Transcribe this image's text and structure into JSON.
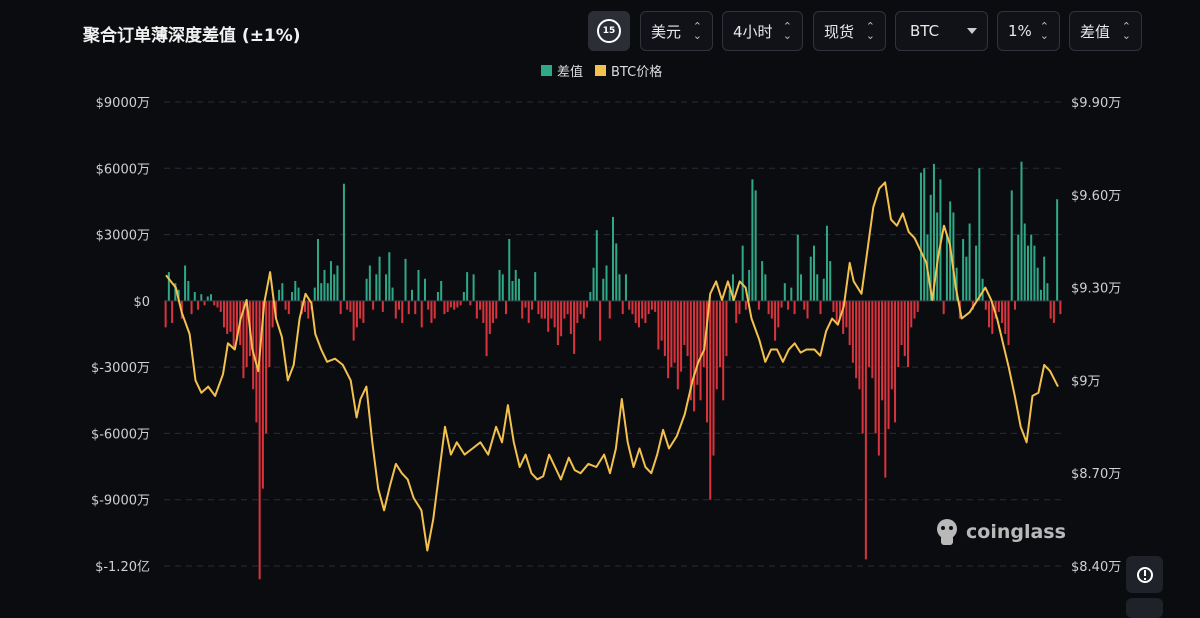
{
  "title": "聚合订单薄深度差值 (±1%)",
  "toolbar": {
    "interval_badge": "15",
    "currency": "美元",
    "timeframe": "4小时",
    "market": "现货",
    "coin": "BTC",
    "range": "1%",
    "metric": "差值"
  },
  "watermark": "coinglass",
  "chart_data": {
    "type": "bar",
    "left_axis_ticks": [
      "$9000万",
      "$6000万",
      "$3000万",
      "$0",
      "$-3000万",
      "$-6000万",
      "$-9000万",
      "$-1.20亿"
    ],
    "right_axis_ticks": [
      "$9.90万",
      "$9.60万",
      "$9.30万",
      "$9万",
      "$8.70万",
      "$8.40万"
    ],
    "left_ylim": [
      -120000000,
      90000000
    ],
    "right_ylim": [
      84000,
      99000
    ],
    "grid": true,
    "legend_position": "top-center",
    "colors": {
      "positive": "#2ea886",
      "negative": "#d9343d",
      "price": "#f2c14e"
    },
    "series": [
      {
        "name": "差值",
        "axis": "left",
        "values_million": [
          -12,
          13,
          -10,
          8,
          5,
          -8,
          16,
          9,
          -6,
          4,
          -4,
          3,
          -2,
          2,
          3,
          -2,
          -3,
          -5,
          -12,
          -15,
          -14,
          -22,
          -18,
          -20,
          -35,
          -30,
          -25,
          -40,
          -55,
          -126,
          -85,
          -60,
          -30,
          -12,
          -8,
          5,
          8,
          -4,
          -6,
          4,
          9,
          6,
          -6,
          -5,
          -8,
          -4,
          6,
          28,
          8,
          14,
          8,
          18,
          12,
          16,
          -6,
          53,
          -4,
          -5,
          -18,
          -12,
          -8,
          -10,
          10,
          16,
          -4,
          12,
          20,
          -5,
          12,
          22,
          6,
          -8,
          -4,
          -10,
          19,
          -6,
          5,
          -6,
          14,
          -12,
          10,
          -4,
          -10,
          -8,
          4,
          9,
          -6,
          -5,
          -3,
          -4,
          -3,
          -2,
          4,
          13,
          -2,
          12,
          -8,
          -4,
          -10,
          -25,
          -15,
          -10,
          -8,
          14,
          12,
          -6,
          28,
          9,
          14,
          10,
          -8,
          -3,
          -10,
          -4,
          13,
          -6,
          -8,
          -8,
          -14,
          -8,
          -12,
          -20,
          -16,
          -8,
          -6,
          -15,
          -24,
          -10,
          -6,
          -8,
          -3,
          4,
          15,
          32,
          -18,
          10,
          16,
          -8,
          38,
          26,
          12,
          -6,
          12,
          -4,
          -6,
          -10,
          -12,
          -8,
          -10,
          -6,
          -4,
          -5,
          -22,
          -18,
          -25,
          -35,
          -30,
          -28,
          -40,
          -32,
          -20,
          -25,
          -45,
          -50,
          -38,
          -45,
          -30,
          -55,
          -90,
          -70,
          -40,
          -30,
          -45,
          -25,
          5,
          12,
          -10,
          -6,
          25,
          -4,
          14,
          55,
          50,
          -4,
          18,
          12,
          -6,
          -8,
          -18,
          -12,
          -3,
          8,
          -4,
          6,
          -6,
          30,
          12,
          -4,
          -8,
          20,
          25,
          12,
          -6,
          10,
          34,
          18,
          -5,
          -10,
          -8,
          -15,
          -12,
          -20,
          -28,
          -35,
          -40,
          -60,
          -117,
          -30,
          -35,
          -60,
          -70,
          -45,
          -80,
          -58,
          -40,
          -55,
          -30,
          -20,
          -25,
          -30,
          -12,
          -8,
          -5,
          58,
          60,
          30,
          48,
          62,
          40,
          55,
          -6,
          30,
          45,
          40,
          15,
          -8,
          28,
          20,
          35,
          -4,
          25,
          60,
          10,
          -4,
          -12,
          -15,
          -8,
          -5,
          -10,
          -15,
          -20,
          50,
          -4,
          30,
          63,
          35,
          25,
          30,
          25,
          15,
          5,
          20,
          8,
          -8,
          -10,
          46,
          -6
        ]
      },
      {
        "name": "BTC价格",
        "axis": "right",
        "x_span": [
          0,
          1
        ],
        "values": [
          [
            0.0,
            93.4
          ],
          [
            0.01,
            93.0
          ],
          [
            0.016,
            92.2
          ],
          [
            0.024,
            91.5
          ],
          [
            0.03,
            90.0
          ],
          [
            0.036,
            89.6
          ],
          [
            0.043,
            89.8
          ],
          [
            0.05,
            89.5
          ],
          [
            0.058,
            90.2
          ],
          [
            0.063,
            91.2
          ],
          [
            0.07,
            91.0
          ],
          [
            0.076,
            92.0
          ],
          [
            0.082,
            92.6
          ],
          [
            0.088,
            91.0
          ],
          [
            0.094,
            90.3
          ],
          [
            0.1,
            92.5
          ],
          [
            0.106,
            93.5
          ],
          [
            0.112,
            92.0
          ],
          [
            0.118,
            91.4
          ],
          [
            0.124,
            90.0
          ],
          [
            0.13,
            90.5
          ],
          [
            0.136,
            92.0
          ],
          [
            0.142,
            92.8
          ],
          [
            0.148,
            92.5
          ],
          [
            0.152,
            91.5
          ],
          [
            0.158,
            91.0
          ],
          [
            0.164,
            90.6
          ],
          [
            0.172,
            90.7
          ],
          [
            0.18,
            90.5
          ],
          [
            0.188,
            90.0
          ],
          [
            0.194,
            88.8
          ],
          [
            0.198,
            89.4
          ],
          [
            0.204,
            89.8
          ],
          [
            0.21,
            88.0
          ],
          [
            0.216,
            86.5
          ],
          [
            0.222,
            85.8
          ],
          [
            0.228,
            86.6
          ],
          [
            0.234,
            87.3
          ],
          [
            0.24,
            87.0
          ],
          [
            0.246,
            86.8
          ],
          [
            0.252,
            86.2
          ],
          [
            0.26,
            85.8
          ],
          [
            0.266,
            84.5
          ],
          [
            0.272,
            85.5
          ],
          [
            0.278,
            87.0
          ],
          [
            0.284,
            88.5
          ],
          [
            0.29,
            87.6
          ],
          [
            0.296,
            88.0
          ],
          [
            0.304,
            87.6
          ],
          [
            0.312,
            87.8
          ],
          [
            0.32,
            88.0
          ],
          [
            0.328,
            87.6
          ],
          [
            0.336,
            88.5
          ],
          [
            0.342,
            88.0
          ],
          [
            0.348,
            89.2
          ],
          [
            0.354,
            88.0
          ],
          [
            0.36,
            87.2
          ],
          [
            0.366,
            87.6
          ],
          [
            0.372,
            87.0
          ],
          [
            0.378,
            86.8
          ],
          [
            0.384,
            86.9
          ],
          [
            0.39,
            87.6
          ],
          [
            0.396,
            87.2
          ],
          [
            0.402,
            86.8
          ],
          [
            0.41,
            87.5
          ],
          [
            0.416,
            87.1
          ],
          [
            0.422,
            87.0
          ],
          [
            0.43,
            87.3
          ],
          [
            0.438,
            87.2
          ],
          [
            0.446,
            87.6
          ],
          [
            0.452,
            87.0
          ],
          [
            0.458,
            87.8
          ],
          [
            0.464,
            89.4
          ],
          [
            0.47,
            88.0
          ],
          [
            0.476,
            87.2
          ],
          [
            0.482,
            87.8
          ],
          [
            0.488,
            87.2
          ],
          [
            0.494,
            87.0
          ],
          [
            0.5,
            87.6
          ],
          [
            0.506,
            88.4
          ],
          [
            0.512,
            87.8
          ],
          [
            0.52,
            88.2
          ],
          [
            0.528,
            88.9
          ],
          [
            0.536,
            90.0
          ],
          [
            0.542,
            90.6
          ],
          [
            0.548,
            91.0
          ],
          [
            0.554,
            92.8
          ],
          [
            0.56,
            93.2
          ],
          [
            0.566,
            92.6
          ],
          [
            0.572,
            93.2
          ],
          [
            0.578,
            92.6
          ],
          [
            0.584,
            93.2
          ],
          [
            0.59,
            93.0
          ],
          [
            0.596,
            92.0
          ],
          [
            0.604,
            91.3
          ],
          [
            0.61,
            90.6
          ],
          [
            0.616,
            91.0
          ],
          [
            0.622,
            91.0
          ],
          [
            0.628,
            90.6
          ],
          [
            0.634,
            91.0
          ],
          [
            0.64,
            91.2
          ],
          [
            0.646,
            90.9
          ],
          [
            0.652,
            91.0
          ],
          [
            0.66,
            91.0
          ],
          [
            0.666,
            90.8
          ],
          [
            0.672,
            91.6
          ],
          [
            0.678,
            92.0
          ],
          [
            0.684,
            91.8
          ],
          [
            0.69,
            92.4
          ],
          [
            0.696,
            93.8
          ],
          [
            0.7,
            93.2
          ],
          [
            0.708,
            92.8
          ],
          [
            0.714,
            94.2
          ],
          [
            0.72,
            95.6
          ],
          [
            0.726,
            96.2
          ],
          [
            0.732,
            96.4
          ],
          [
            0.738,
            95.2
          ],
          [
            0.744,
            95.0
          ],
          [
            0.75,
            95.4
          ],
          [
            0.756,
            94.8
          ],
          [
            0.762,
            94.6
          ],
          [
            0.768,
            94.2
          ],
          [
            0.774,
            93.8
          ],
          [
            0.78,
            92.6
          ],
          [
            0.786,
            94.0
          ],
          [
            0.792,
            95.0
          ],
          [
            0.798,
            94.4
          ],
          [
            0.804,
            93.0
          ],
          [
            0.81,
            92.0
          ],
          [
            0.818,
            92.2
          ],
          [
            0.826,
            92.6
          ],
          [
            0.834,
            93.0
          ],
          [
            0.84,
            92.6
          ],
          [
            0.846,
            92.0
          ],
          [
            0.852,
            91.2
          ],
          [
            0.858,
            90.4
          ],
          [
            0.864,
            89.5
          ],
          [
            0.87,
            88.5
          ],
          [
            0.876,
            88.0
          ],
          [
            0.882,
            89.5
          ],
          [
            0.888,
            89.6
          ],
          [
            0.894,
            90.5
          ],
          [
            0.9,
            90.3
          ],
          [
            0.908,
            89.8
          ]
        ]
      }
    ]
  }
}
